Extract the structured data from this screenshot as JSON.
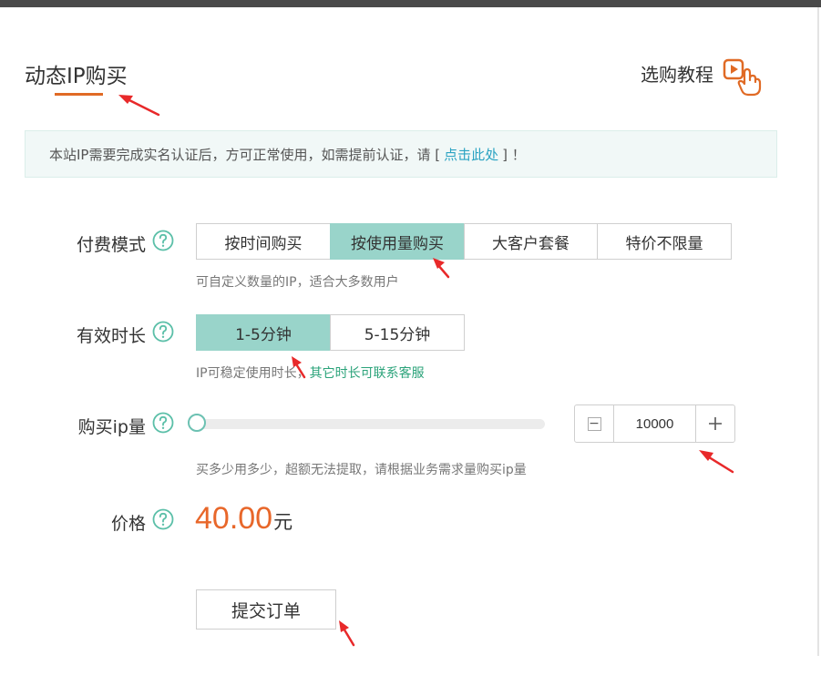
{
  "header": {
    "title": "动态IP购买",
    "tutorial_label": "选购教程"
  },
  "notice": {
    "text_before": "本站IP需要完成实名认证后，方可正常使用，如需提前认证，请 [",
    "link_text": "点击此处",
    "text_after": "] ！"
  },
  "payment_mode": {
    "label": "付费模式",
    "options": [
      "按时间购买",
      "按使用量购买",
      "大客户套餐",
      "特价不限量"
    ],
    "selected": "按使用量购买",
    "hint": "可自定义数量的IP，适合大多数用户"
  },
  "duration": {
    "label": "有效时长",
    "options": [
      "1-5分钟",
      "5-15分钟"
    ],
    "selected": "1-5分钟",
    "hint": "IP可稳定使用时长，",
    "hint_link": "其它时长可联系客服"
  },
  "quantity": {
    "label": "购买ip量",
    "value": "10000",
    "slider_level": 0,
    "hint": "买多少用多少，超额无法提取，请根据业务需求量购买ip量"
  },
  "price": {
    "label": "价格",
    "amount": "40.00",
    "unit": "元"
  },
  "submit": {
    "label": "提交订单"
  },
  "colors": {
    "accent_orange": "#e06a25",
    "selected_teal": "#99d4ca",
    "price_orange": "#e8672a",
    "link_blue": "#2ba3c2",
    "link_green": "#2ba37a",
    "annotation_red": "#e8292a"
  },
  "icons": {
    "help": "question-circle-icon",
    "tutorial": "play-hand-pointer-icon"
  }
}
